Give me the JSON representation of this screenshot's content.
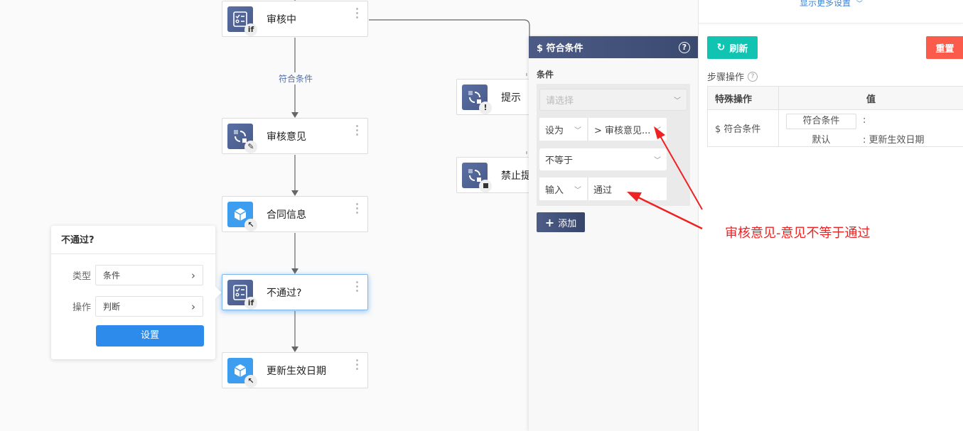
{
  "flow": {
    "nodes": [
      {
        "id": "shenhezhong",
        "label": "审核中",
        "icon": "checklist-icon",
        "badge": "if",
        "style": "dark"
      },
      {
        "id": "shenheyijian",
        "label": "审核意见",
        "icon": "loop-icon",
        "badge": "edit",
        "style": "dark"
      },
      {
        "id": "hetongxinxi",
        "label": "合同信息",
        "icon": "cube-icon",
        "badge": "cursor",
        "style": "blue"
      },
      {
        "id": "butongguo",
        "label": "不通过?",
        "icon": "checklist-icon",
        "badge": "if",
        "style": "dark",
        "selected": true
      },
      {
        "id": "gengxin",
        "label": "更新生效日期",
        "icon": "cube-icon",
        "badge": "cursor",
        "style": "blue"
      },
      {
        "id": "tishi",
        "label": "提示",
        "icon": "loop-icon",
        "badge": "alert",
        "style": "dark"
      },
      {
        "id": "jinzhi",
        "label": "禁止提",
        "icon": "loop-icon",
        "badge": "stop",
        "style": "dark"
      }
    ],
    "edge_label": "符合条件",
    "badges": {
      "if": "if",
      "alert": "!"
    }
  },
  "popover": {
    "title": "不通过?",
    "type_label": "类型",
    "type_value": "条件",
    "op_label": "操作",
    "op_value": "判断",
    "chevron": "›",
    "set_button": "设置"
  },
  "condition_panel": {
    "title": "$ 符合条件",
    "help": "?",
    "section_label": "条件",
    "select_placeholder": "请选择",
    "row1_mode": "设为",
    "row1_value": "> 审核意见...",
    "operator": "不等于",
    "row3_mode": "输入",
    "row3_value": "通过",
    "add_button": "添加",
    "add_icon": "+"
  },
  "right_panel": {
    "more_settings": "显示更多设置",
    "refresh_button": "刷新",
    "reset_button": "重置",
    "steps_label": "步骤操作",
    "table": {
      "headers": [
        "特殊操作",
        "值"
      ],
      "rows": [
        {
          "op": "$ 符合条件",
          "value_button": "符合条件",
          "value_colon": ":",
          "default_label": "默认",
          "default_value": ": 更新生效日期"
        }
      ]
    }
  },
  "annotation": {
    "text": "审核意见-意见不等于通过",
    "color": "#ee2222"
  }
}
